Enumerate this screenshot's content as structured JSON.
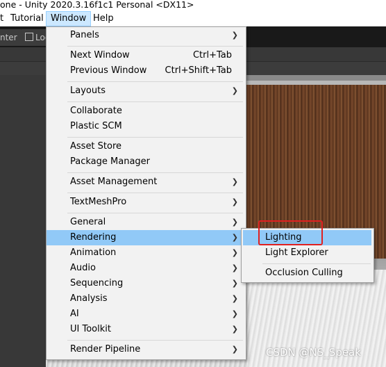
{
  "window": {
    "title": "one - Unity 2020.3.16f1c1 Personal <DX11>"
  },
  "menubar": {
    "items": [
      {
        "label": "t"
      },
      {
        "label": "Tutorial"
      },
      {
        "label": "Window"
      },
      {
        "label": "Help"
      }
    ]
  },
  "editor": {
    "tabs": [
      {
        "label": "nter"
      },
      {
        "label": "Loc"
      }
    ],
    "zoom_fragment": "0",
    "gizmo_icon": "grid-snap-icon"
  },
  "window_menu": {
    "items": [
      {
        "label": "Panels",
        "submenu": true
      },
      {
        "label": "Next Window",
        "shortcut": "Ctrl+Tab"
      },
      {
        "label": "Previous Window",
        "shortcut": "Ctrl+Shift+Tab"
      },
      {
        "label": "Layouts",
        "submenu": true
      },
      {
        "label": "Collaborate"
      },
      {
        "label": "Plastic SCM"
      },
      {
        "label": "Asset Store"
      },
      {
        "label": "Package Manager"
      },
      {
        "label": "Asset Management",
        "submenu": true
      },
      {
        "label": "TextMeshPro",
        "submenu": true
      },
      {
        "label": "General",
        "submenu": true
      },
      {
        "label": "Rendering",
        "submenu": true,
        "highlighted": true
      },
      {
        "label": "Animation",
        "submenu": true
      },
      {
        "label": "Audio",
        "submenu": true
      },
      {
        "label": "Sequencing",
        "submenu": true
      },
      {
        "label": "Analysis",
        "submenu": true
      },
      {
        "label": "AI",
        "submenu": true
      },
      {
        "label": "UI Toolkit",
        "submenu": true
      },
      {
        "label": "Render Pipeline",
        "submenu": true
      }
    ]
  },
  "rendering_submenu": {
    "items": [
      {
        "label": "Lighting",
        "highlighted": true
      },
      {
        "label": "Light Explorer"
      },
      {
        "label": "Occlusion Culling"
      }
    ]
  },
  "watermark": "CSDN @NS_Speak",
  "colors": {
    "highlight": "#91c9f7",
    "menubar_active": "#cce8ff",
    "annotation_box": "#e02020"
  }
}
